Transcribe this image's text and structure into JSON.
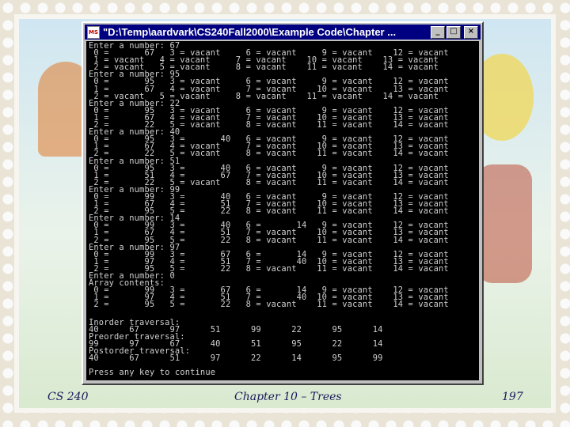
{
  "window": {
    "title": "\"D:\\Temp\\aardvark\\CS240Fall2000\\Example Code\\Chapter ...",
    "icon_text": "MS",
    "buttons": [
      "_",
      "□",
      "×"
    ]
  },
  "console": {
    "lines": [
      "Enter a number: 67",
      " 0 =       67   3 = vacant     6 = vacant     9 = vacant    12 = vacant",
      " 1 = vacant   4 = vacant     7 = vacant    10 = vacant    13 = vacant",
      " 2 = vacant   5 = vacant     8 = vacant    11 = vacant    14 = vacant",
      "Enter a number: 95",
      " 0 =       95   3 = vacant     6 = vacant     9 = vacant    12 = vacant",
      " 1 =       67   4 = vacant     7 = vacant    10 = vacant    13 = vacant",
      " 2 = vacant   5 = vacant     8 = vacant    11 = vacant    14 = vacant",
      "Enter a number: 22",
      " 0 =       95   3 = vacant     6 = vacant     9 = vacant    12 = vacant",
      " 1 =       67   4 = vacant     7 = vacant    10 = vacant    13 = vacant",
      " 2 =       22   5 = vacant     8 = vacant    11 = vacant    14 = vacant",
      "Enter a number: 40",
      " 0 =       95   3 =       40   6 = vacant     9 = vacant    12 = vacant",
      " 1 =       67   4 = vacant     7 = vacant    10 = vacant    13 = vacant",
      " 2 =       22   5 = vacant     8 = vacant    11 = vacant    14 = vacant",
      "Enter a number: 51",
      " 0 =       95   3 =       40   6 = vacant     9 = vacant    12 = vacant",
      " 1 =       51   4 =       67   7 = vacant    10 = vacant    13 = vacant",
      " 2 =       22   5 = vacant     8 = vacant    11 = vacant    14 = vacant",
      "Enter a number: 99",
      " 0 =       99   3 =       40   6 = vacant     9 = vacant    12 = vacant",
      " 1 =       67   4 =       51   7 = vacant    10 = vacant    13 = vacant",
      " 2 =       95   5 =       22   8 = vacant    11 = vacant    14 = vacant",
      "Enter a number: 14",
      " 0 =       99   3 =       40   6 =       14   9 = vacant    12 = vacant",
      " 1 =       67   4 =       51   7 = vacant    10 = vacant    13 = vacant",
      " 2 =       95   5 =       22   8 = vacant    11 = vacant    14 = vacant",
      "Enter a number: 97",
      " 0 =       99   3 =       67   6 =       14   9 = vacant    12 = vacant",
      " 1 =       97   4 =       51   7 =       40  10 = vacant    13 = vacant",
      " 2 =       95   5 =       22   8 = vacant    11 = vacant    14 = vacant",
      "Enter a number: 0",
      "Array contents:",
      " 0 =       99   3 =       67   6 =       14   9 = vacant    12 = vacant",
      " 1 =       97   4 =       51   7 =       40  10 = vacant    13 = vacant",
      " 2 =       95   5 =       22   8 = vacant    11 = vacant    14 = vacant"
    ],
    "traversals": [
      "",
      "Inorder traversal:",
      "40      67      97      51      99      22      95      14",
      "Preorder traversal:",
      "99      97      67      40      51      95      22      14",
      "Postorder traversal:",
      "40      67      51      97      22      14      95      99",
      "",
      "Press any key to continue"
    ]
  },
  "footer": {
    "course": "CS 240",
    "chapter": "Chapter 10 – Trees",
    "page": "197"
  },
  "colors": {
    "titlebar": "#000080",
    "console_bg": "#000000",
    "console_text": "#d0d0d0",
    "footer_text": "#1a1a5a"
  }
}
